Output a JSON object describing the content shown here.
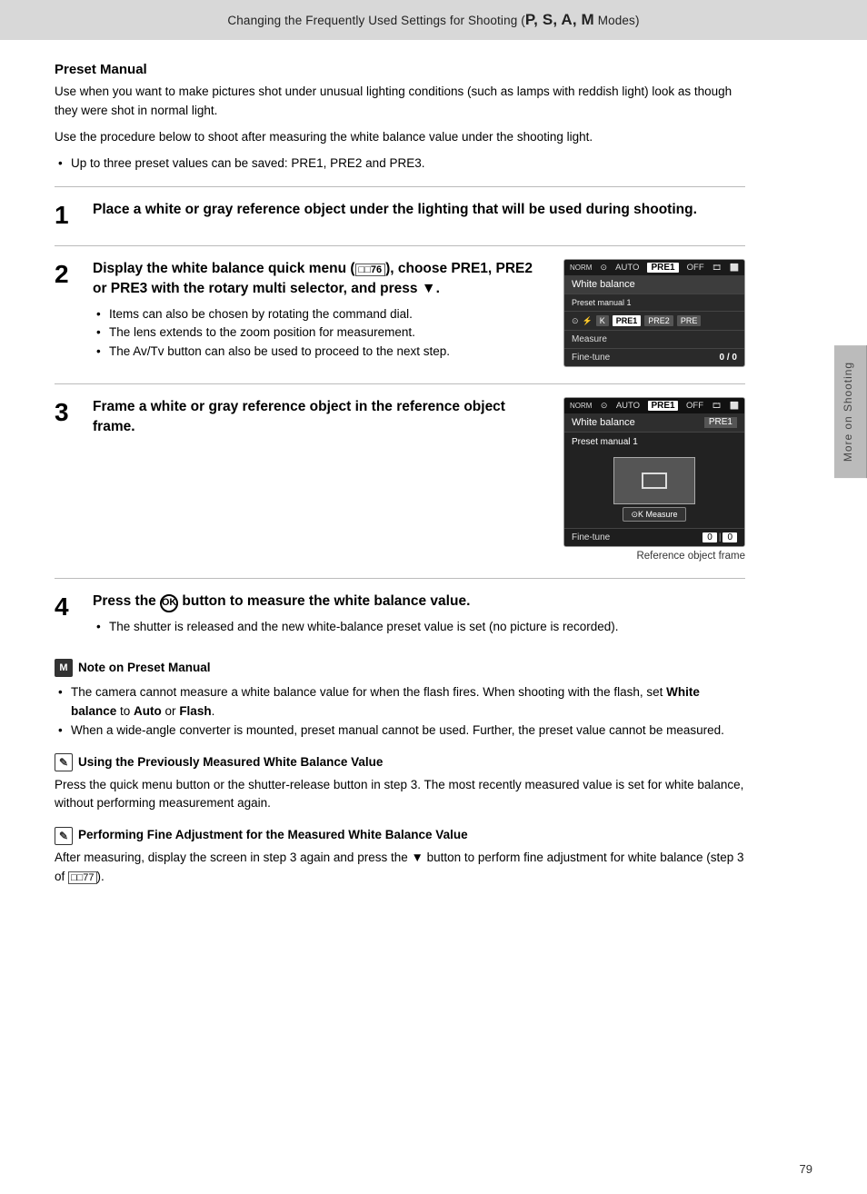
{
  "header": {
    "text": "Changing the Frequently Used Settings for Shooting (",
    "modes": "P, S, A, M",
    "text_suffix": " Modes)"
  },
  "sidebar": {
    "label": "More on Shooting"
  },
  "page_number": "79",
  "section": {
    "title": "Preset Manual",
    "intro1": "Use when you want to make pictures shot under unusual lighting conditions (such as lamps with reddish light) look as though they were shot in normal light.",
    "intro2": "Use the procedure below to shoot after measuring the white balance value under the shooting light.",
    "bullet1": "Up to three preset values can be saved: PRE1, PRE2 and PRE3."
  },
  "steps": [
    {
      "number": "1",
      "title": "Place a white or gray reference object under the lighting that will be used during shooting."
    },
    {
      "number": "2",
      "title": "Display the white balance quick menu (",
      "title_ref": "76",
      "title_suffix": "), choose PRE1, PRE2 or PRE3 with the rotary multi selector, and press",
      "title_end": "▼.",
      "bullets": [
        "Items can also be chosen by rotating the command dial.",
        "The lens extends to the zoom position for measurement.",
        "The Av/Tv button can also be used to proceed to the next step."
      ],
      "cam_ui": {
        "top_bar": [
          "NORM",
          "AUTO",
          "PRE1",
          "OFF"
        ],
        "menu_title": "White balance",
        "preset_label": "Preset manual 1",
        "preset_options": [
          "K",
          "PRE1",
          "PRE2",
          "PRE"
        ],
        "rows": [
          {
            "label": "Measure",
            "value": ""
          },
          {
            "label": "Fine-tune",
            "value": "0 / 0"
          }
        ]
      }
    },
    {
      "number": "3",
      "title": "Frame a white or gray reference object in the reference object frame.",
      "cam_ui2": {
        "top_bar": [
          "NORM",
          "AUTO",
          "PRE1",
          "OFF"
        ],
        "menu_title": "White balance",
        "menu_right": "PRE1",
        "preset_label": "Preset manual 1",
        "finetune_label": "Fine-tune",
        "finetune_vals": [
          "0",
          "0"
        ],
        "ref_label": "Reference object frame"
      }
    },
    {
      "number": "4",
      "title_pre": "Press the",
      "title_symbol": "OK",
      "title_post": "button to measure the white balance value.",
      "bullets": [
        "The shutter is released and the new white-balance preset value is set (no picture is recorded)."
      ]
    }
  ],
  "note_preset": {
    "icon": "M",
    "title": "Note on Preset Manual",
    "bullets": [
      "The camera cannot measure a white balance value for when the flash fires. When shooting with the flash, set White balance to Auto or Flash.",
      "When a wide-angle converter is mounted, preset manual cannot be used. Further, the preset value cannot be measured."
    ],
    "bold_parts": [
      "White balance",
      "Auto",
      "Flash"
    ]
  },
  "tip_using": {
    "icon": "pencil",
    "title": "Using the Previously Measured White Balance Value",
    "text": "Press the quick menu button or the shutter-release button in step 3. The most recently measured value is set for white balance, without performing measurement again."
  },
  "tip_fine": {
    "icon": "pencil",
    "title": "Performing Fine Adjustment for the Measured White Balance Value",
    "text": "After measuring, display the screen in step 3 again and press the ▼ button to perform fine adjustment for white balance (step 3 of",
    "ref": "77",
    "text_suffix": ")."
  }
}
